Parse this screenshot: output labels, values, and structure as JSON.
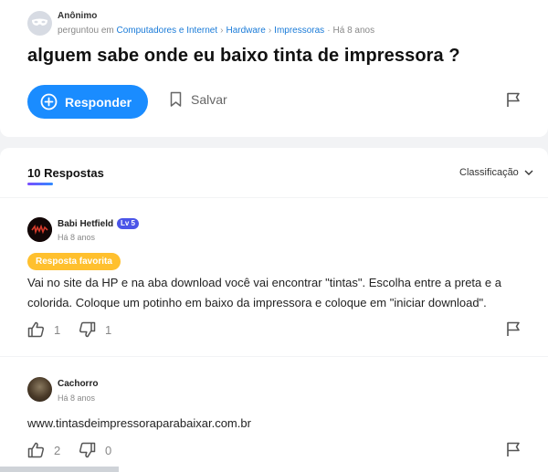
{
  "question": {
    "asker_name": "Anônimo",
    "asked_verb": "perguntou em",
    "breadcrumbs": [
      "Computadores e Internet",
      "Hardware",
      "Impressoras"
    ],
    "time": "Há 8 anos",
    "title": "alguem sabe onde eu baixo tinta de impressora ?",
    "reply_label": "Responder",
    "save_label": "Salvar"
  },
  "answers_header": {
    "count_label": "10 Respostas",
    "sort_label": "Classificação"
  },
  "answers": [
    {
      "user": "Babi Hetfield",
      "level": "Lv 5",
      "time": "Há 8 anos",
      "badge": "Resposta favorita",
      "text": "Vai no site da HP e na aba download você vai encontrar \"tintas\". Escolha entre a preta e a colorida. Coloque um potinho em baixo da impressora e coloque em \"iniciar download\".",
      "likes": "1",
      "dislikes": "1"
    },
    {
      "user": "Cachorro",
      "time": "Há 8 anos",
      "text": "www.tintasdeimpressoraparabaixar.com.br",
      "likes": "2",
      "dislikes": "0"
    }
  ],
  "icons": {
    "accent": "#1a8cff",
    "fav_color": "#ffc02e",
    "level_color": "#4b55e8"
  }
}
